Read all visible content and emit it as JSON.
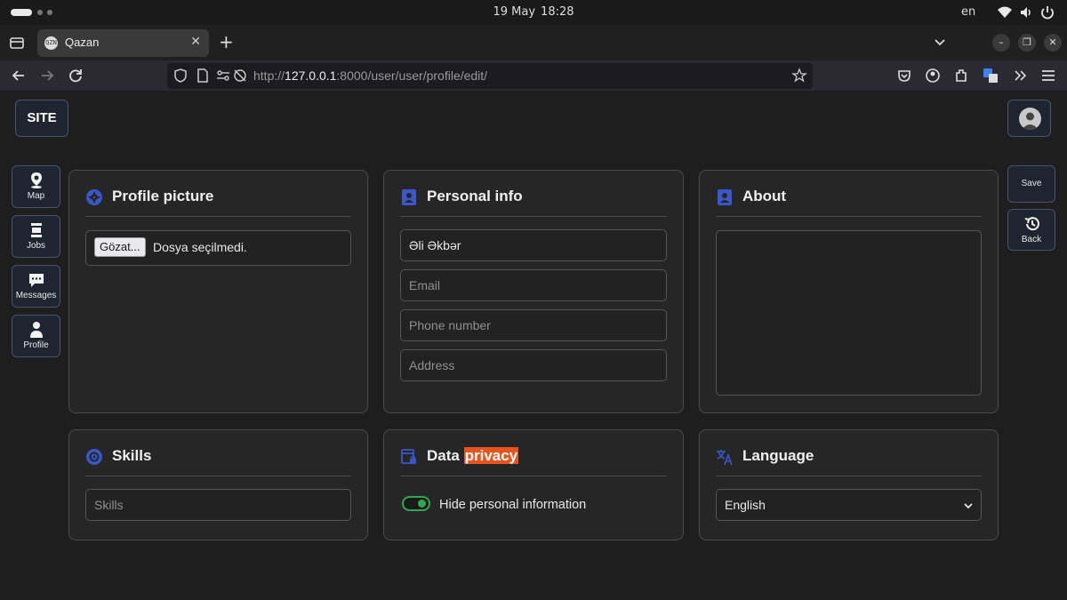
{
  "os": {
    "date": "19 May",
    "time": "18:28",
    "keyboard_lang": "en"
  },
  "browser": {
    "tab_title": "Qazan",
    "tab_favicon_text": "QZN",
    "url_prefix": "http://",
    "url_host": "127.0.0.1",
    "url_rest": ":8000/user/user/profile/edit/"
  },
  "header": {
    "logo_text": "SITE"
  },
  "sidebar": {
    "items": [
      {
        "label": "Map",
        "icon": "map-pin-icon"
      },
      {
        "label": "Jobs",
        "icon": "briefcase-icon"
      },
      {
        "label": "Messages",
        "icon": "chat-bubble-icon"
      },
      {
        "label": "Profile",
        "icon": "person-icon"
      }
    ]
  },
  "actions": {
    "save_label": "Save",
    "back_label": "Back"
  },
  "cards": {
    "profile_picture": {
      "title": "Profile picture",
      "file_button": "Gözat...",
      "file_status": "Dosya seçilmedi."
    },
    "personal_info": {
      "title": "Personal info",
      "name_value": "Əli Əkbər",
      "email_placeholder": "Email",
      "phone_placeholder": "Phone number",
      "address_placeholder": "Address"
    },
    "about": {
      "title": "About",
      "value": ""
    },
    "skills": {
      "title": "Skills",
      "placeholder": "Skills"
    },
    "data_privacy": {
      "title_main": "Data",
      "title_highlight": "privacy",
      "toggle_label": "Hide personal information",
      "toggle_on": true
    },
    "language": {
      "title": "Language",
      "selected": "English"
    }
  },
  "colors": {
    "accent_icon": "#3a56c9",
    "highlight": "#e8541e",
    "toggle_green": "#2fa84f"
  }
}
